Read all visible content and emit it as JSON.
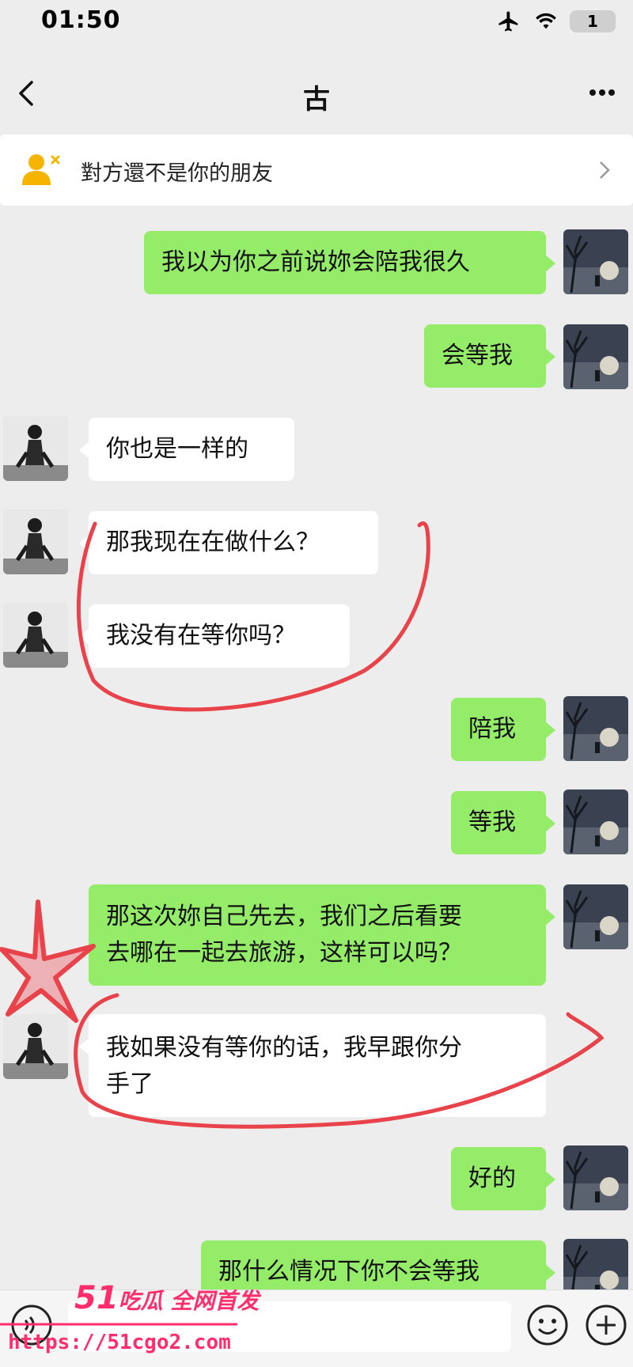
{
  "status": {
    "time": "01:50",
    "battery": "1"
  },
  "nav": {
    "title": "古"
  },
  "banner": {
    "text": "對方還不是你的朋友"
  },
  "messages": [
    {
      "side": "me",
      "text": "我以为你之前说妳会陪我很久"
    },
    {
      "side": "me",
      "text": "会等我"
    },
    {
      "side": "them",
      "text": "你也是一样的"
    },
    {
      "side": "them",
      "text": "那我现在在做什么？"
    },
    {
      "side": "them",
      "text": "我没有在等你吗？"
    },
    {
      "side": "me",
      "text": "陪我"
    },
    {
      "side": "me",
      "text": "等我"
    },
    {
      "side": "me",
      "text": "那这次妳自己先去，我们之后看要\n去哪在一起去旅游，这样可以吗？"
    },
    {
      "side": "them",
      "text": "我如果没有等你的话，我早跟你分\n手了"
    },
    {
      "side": "me",
      "text": "好的"
    },
    {
      "side": "me",
      "text": "那什么情况下你不会等我"
    }
  ],
  "watermark": {
    "brand_num": "51",
    "brand_text": "吃瓜 全网首发",
    "url": "https://51cgo2.com"
  },
  "colors": {
    "me_bubble": "#95ec69",
    "them_bubble": "#ffffff",
    "annotation": "#e8424a",
    "watermark": "#ff2d6b"
  }
}
